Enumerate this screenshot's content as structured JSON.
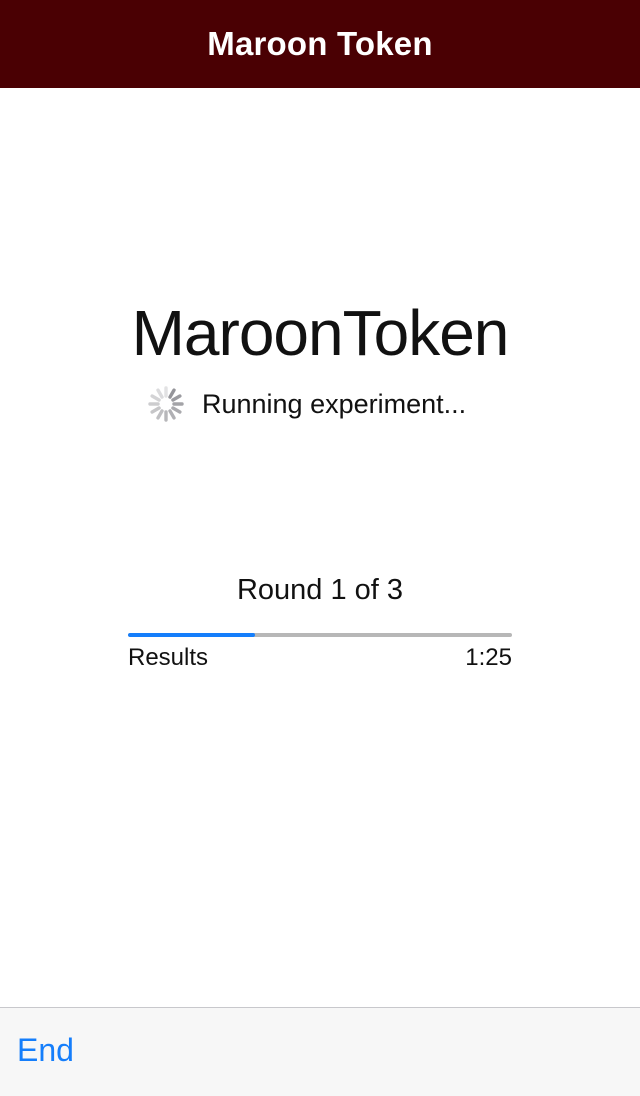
{
  "nav": {
    "title": "Maroon Token",
    "background_color": "#4a0003"
  },
  "main": {
    "app_name": "MaroonToken",
    "status_text": "Running experiment...",
    "spinner_icon": "activity-spinner-icon"
  },
  "round": {
    "label": "Round 1 of 3",
    "progress_fraction": 0.33,
    "progress_color": "#157efb",
    "track_color": "#b7b7b7",
    "left_label": "Results",
    "time_remaining": "1:25"
  },
  "toolbar": {
    "end_label": "End",
    "accent_color": "#157efb"
  }
}
